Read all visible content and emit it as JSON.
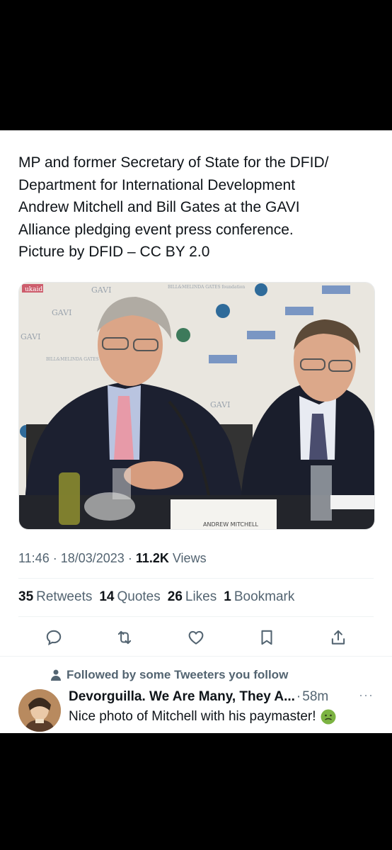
{
  "tweet": {
    "text": "MP and former Secretary of State for the DFID/\nDepartment for International Development\nAndrew Mitchell and Bill Gates at the GAVI\nAlliance pledging event press conference.\nPicture by DFID – CC BY 2.0",
    "time": "11:46",
    "date": "18/03/2023",
    "views_count": "11.2K",
    "views_label": "Views"
  },
  "media": {
    "backdrop_labels": [
      "ukaid",
      "GAVI",
      "BILL&MELINDA GATES foundation"
    ],
    "nameplate": "ANDREW MITCHELL"
  },
  "stats": [
    {
      "count": "35",
      "label": "Retweets"
    },
    {
      "count": "14",
      "label": "Quotes"
    },
    {
      "count": "26",
      "label": "Likes"
    },
    {
      "count": "1",
      "label": "Bookmark"
    }
  ],
  "actions": {
    "icons": [
      "reply-icon",
      "retweet-icon",
      "like-icon",
      "bookmark-icon",
      "share-icon"
    ]
  },
  "reply": {
    "social_context": "Followed by some Tweeters you follow",
    "name": "Devorguilla. We Are Many, They A...",
    "separator": "·",
    "time": "58m",
    "more": "···",
    "text": "Nice photo of Mitchell with his paymaster!",
    "emoji_icon": "nauseated-face-icon"
  },
  "colors": {
    "text_primary": "#0f1419",
    "text_secondary": "#536471",
    "divider": "#eff3f4",
    "emoji": "#7cb342"
  }
}
